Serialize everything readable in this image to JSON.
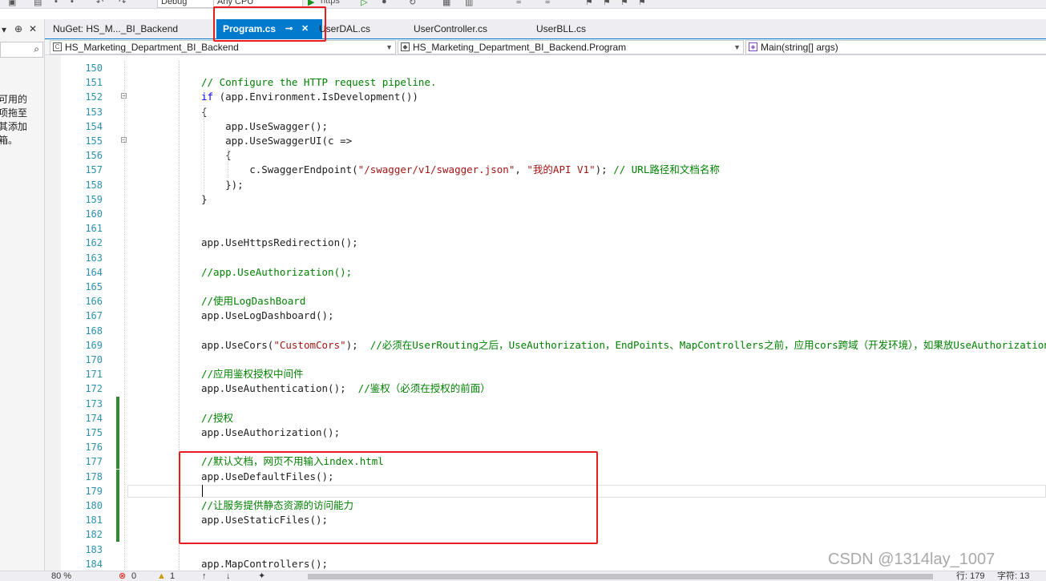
{
  "toolbar": {
    "configuration": "Debug",
    "platform": "Any CPU",
    "run_profile": "https"
  },
  "left_panel": {
    "pin_glyph": "▾ ⊕ ✕",
    "search_icon": "search-icon",
    "hint_text": "可用的\n项拖至\n其添加\n箱。"
  },
  "tabs": [
    {
      "label": "NuGet: HS_M..._BI_Backend",
      "active": false
    },
    {
      "label": "Program.cs",
      "active": true,
      "pin_glyph": "⊸",
      "close_glyph": "✕"
    },
    {
      "label": "UserDAL.cs",
      "active": false
    },
    {
      "label": "UserController.cs",
      "active": false
    },
    {
      "label": "UserBLL.cs",
      "active": false
    }
  ],
  "navbar": {
    "project": "HS_Marketing_Department_BI_Backend",
    "type": "HS_Marketing_Department_BI_Backend.Program",
    "member": "Main(string[] args)"
  },
  "editor": {
    "lines": [
      {
        "n": "150",
        "t": ""
      },
      {
        "n": "151",
        "t": "// Configure the HTTP request pipeline."
      },
      {
        "n": "152",
        "t": "if (app.Environment.IsDevelopment())"
      },
      {
        "n": "153",
        "t": "{"
      },
      {
        "n": "154",
        "t": "    app.UseSwagger();"
      },
      {
        "n": "155",
        "t": "    app.UseSwaggerUI(c =>"
      },
      {
        "n": "156",
        "t": "    {"
      },
      {
        "n": "157",
        "t": "        c.SwaggerEndpoint(\"/swagger/v1/swagger.json\", \"我的API V1\"); // URL路径和文档名称"
      },
      {
        "n": "158",
        "t": "    });"
      },
      {
        "n": "159",
        "t": "}"
      },
      {
        "n": "160",
        "t": ""
      },
      {
        "n": "161",
        "t": ""
      },
      {
        "n": "162",
        "t": "app.UseHttpsRedirection();"
      },
      {
        "n": "163",
        "t": ""
      },
      {
        "n": "164",
        "t": "//app.UseAuthorization();"
      },
      {
        "n": "165",
        "t": ""
      },
      {
        "n": "166",
        "t": "//使用LogDashBoard"
      },
      {
        "n": "167",
        "t": "app.UseLogDashboard();"
      },
      {
        "n": "168",
        "t": ""
      },
      {
        "n": "169",
        "t": "app.UseCors(\"CustomCors\");  //必须在UserRouting之后，UseAuthorization，EndPoints、MapControllers之前，应用cors跨域（开发环境），如果放UseAuthorization"
      },
      {
        "n": "170",
        "t": ""
      },
      {
        "n": "171",
        "t": "//应用鉴权授权中间件"
      },
      {
        "n": "172",
        "t": "app.UseAuthentication();  //鉴权（必须在授权的前面）"
      },
      {
        "n": "173",
        "t": ""
      },
      {
        "n": "174",
        "t": "//授权"
      },
      {
        "n": "175",
        "t": "app.UseAuthorization();"
      },
      {
        "n": "176",
        "t": ""
      },
      {
        "n": "177",
        "t": "//默认文档，网页不用输入index.html"
      },
      {
        "n": "178",
        "t": "app.UseDefaultFiles();"
      },
      {
        "n": "179",
        "t": ""
      },
      {
        "n": "180",
        "t": "//让服务提供静态资源的访问能力"
      },
      {
        "n": "181",
        "t": "app.UseStaticFiles();"
      },
      {
        "n": "182",
        "t": ""
      },
      {
        "n": "183",
        "t": ""
      },
      {
        "n": "184",
        "t": "app.MapControllers();"
      }
    ]
  },
  "status": {
    "zoom": "80 %",
    "errors": "0",
    "warnings": "1",
    "line": "行: 179",
    "col": "字符: 13"
  },
  "watermark": "CSDN @1314lay_1007",
  "colors": {
    "accent": "#007acc",
    "keyword": "#0000ff",
    "comment": "#008000",
    "string": "#a31515",
    "line_number": "#2b91af",
    "highlight_box": "#e81c1c",
    "change_bar": "#2e8b2e"
  }
}
